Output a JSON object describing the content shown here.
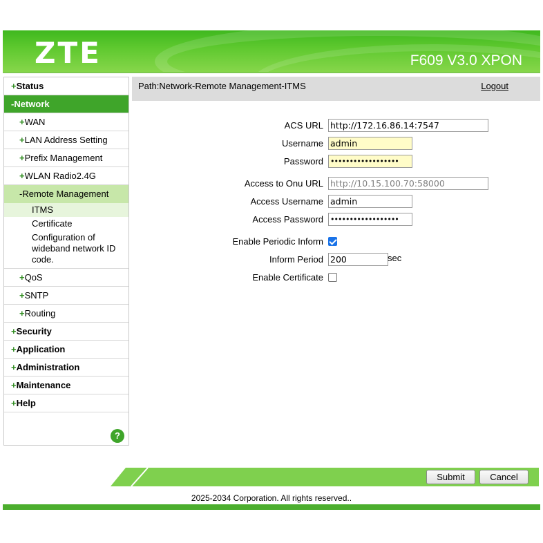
{
  "header": {
    "logo": "ZTE",
    "model": "F609 V3.0 XPON",
    "colors": {
      "brand_green": "#3fb81f",
      "nav_active": "#3fa52a",
      "submenu_active": "#c7e7a9"
    }
  },
  "path": {
    "text": "Path:Network-Remote Management-ITMS",
    "logout": "Logout"
  },
  "sidebar": {
    "status": "Status",
    "network": "Network",
    "wan": "WAN",
    "lan": "LAN Address Setting",
    "prefix": "Prefix Management",
    "wlan": "WLAN Radio2.4G",
    "remote": "Remote Management",
    "itms": "ITMS",
    "certificate": "Certificate",
    "config_wideband": "Configuration of wideband network ID code.",
    "qos": "QoS",
    "sntp": "SNTP",
    "routing": "Routing",
    "security": "Security",
    "application": "Application",
    "administration": "Administration",
    "maintenance": "Maintenance",
    "help": "Help",
    "plus": "+",
    "minus": "-",
    "help_icon": "?"
  },
  "form": {
    "acs_url_label": "ACS URL",
    "acs_url": "http://172.16.86.14:7547",
    "username_label": "Username",
    "username": "admin",
    "password_label": "Password",
    "password": "••••••••••••••••••",
    "onu_url_label": "Access to Onu URL",
    "onu_url": "http://10.15.100.70:58000",
    "access_username_label": "Access Username",
    "access_username": "admin",
    "access_password_label": "Access Password",
    "access_password": "••••••••••••••••••",
    "periodic_label": "Enable Periodic Inform",
    "periodic_checked": true,
    "inform_period_label": "Inform Period",
    "inform_period": "200",
    "inform_unit": "sec",
    "cert_label": "Enable Certificate",
    "cert_checked": false
  },
  "buttons": {
    "submit": "Submit",
    "cancel": "Cancel"
  },
  "footer": {
    "copyright": "2025-2034 Corporation. All rights reserved.."
  }
}
